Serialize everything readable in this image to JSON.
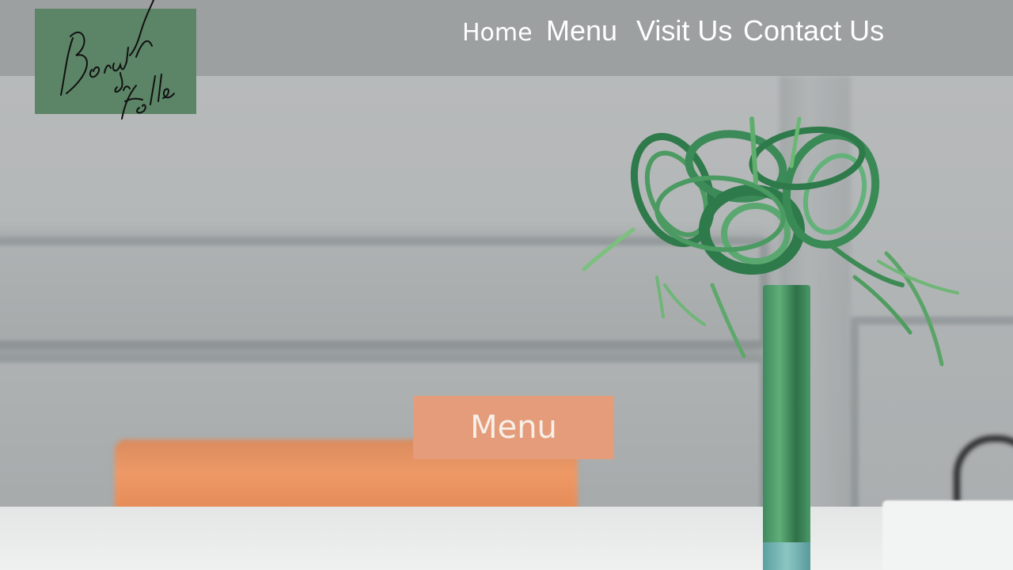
{
  "brand": {
    "logo_icon": "signature-logo",
    "logo_bg_color": "#5c8467"
  },
  "nav": {
    "items": [
      {
        "label": "Home"
      },
      {
        "label": "Menu"
      },
      {
        "label": "Visit Us"
      },
      {
        "label": "Contact Us"
      }
    ]
  },
  "hero": {
    "cta_label": "Menu",
    "cta_color": "#e59c7a"
  },
  "colors": {
    "header_bg": "#9b9e9e",
    "nav_text": "#ffffff"
  }
}
